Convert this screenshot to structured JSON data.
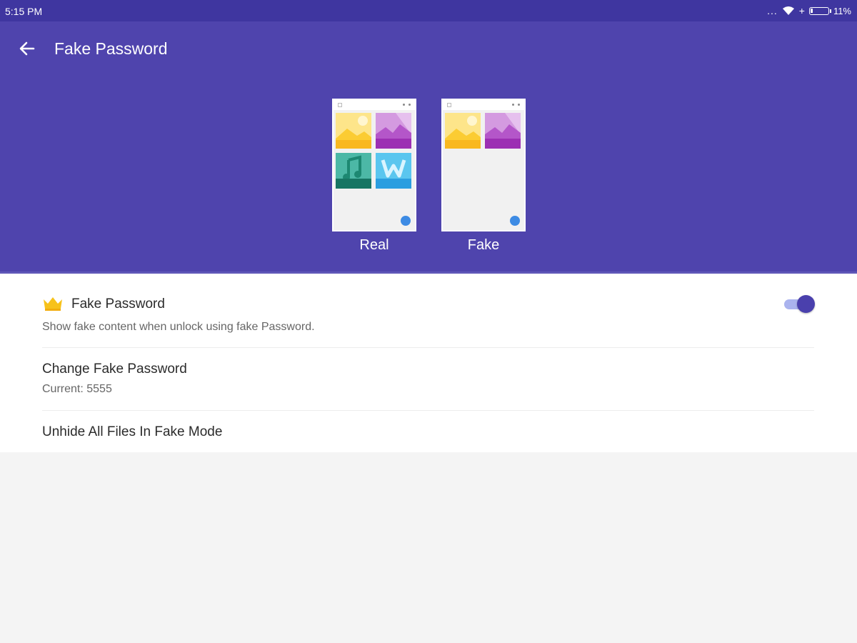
{
  "status_bar": {
    "time": "5:15 PM",
    "overflow_dots": "...",
    "battery_percent": "11%",
    "battery_level": 0.11,
    "icons": [
      "wifi-icon",
      "charging-plus-icon",
      "battery-icon"
    ]
  },
  "app_bar": {
    "title": "Fake Password",
    "back_icon": "arrow-left-icon",
    "color": "#4f44ad"
  },
  "previews": [
    {
      "label": "Real",
      "tiles": [
        "image-yellow",
        "image-purple",
        "music-teal",
        "document-blue"
      ]
    },
    {
      "label": "Fake",
      "tiles": [
        "image-yellow",
        "image-purple"
      ]
    }
  ],
  "settings": {
    "fake_password": {
      "title": "Fake Password",
      "subtitle": "Show fake content when unlock using fake Password.",
      "enabled": true,
      "icon": "crown-icon"
    },
    "change_password": {
      "title": "Change Fake Password",
      "subtitle": "Current: 5555"
    },
    "unhide_all": {
      "title": "Unhide All Files In Fake Mode"
    }
  },
  "colors": {
    "accent": "#4f44ad",
    "toggle_thumb": "#4a40ad",
    "toggle_track": "#aab3ee",
    "crown": "#f7c21b"
  }
}
